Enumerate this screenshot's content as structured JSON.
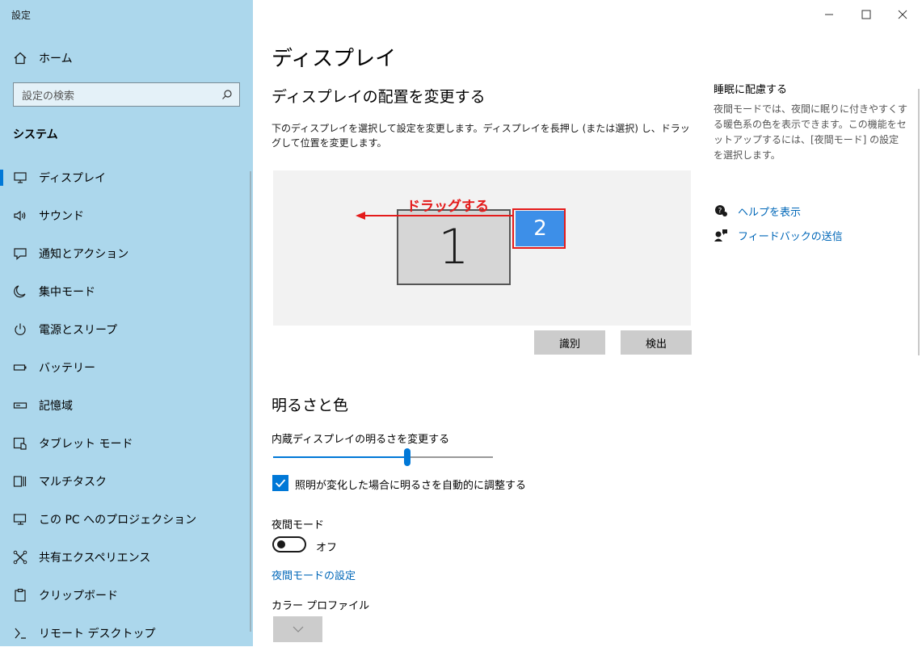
{
  "window": {
    "title": "設定"
  },
  "sidebar": {
    "home": "ホーム",
    "search_placeholder": "設定の検索",
    "section": "システム",
    "items": [
      {
        "label": "ディスプレイ",
        "icon": "monitor-icon",
        "selected": true
      },
      {
        "label": "サウンド",
        "icon": "speaker-icon"
      },
      {
        "label": "通知とアクション",
        "icon": "notification-icon"
      },
      {
        "label": "集中モード",
        "icon": "moon-icon"
      },
      {
        "label": "電源とスリープ",
        "icon": "power-icon"
      },
      {
        "label": "バッテリー",
        "icon": "battery-icon"
      },
      {
        "label": "記憶域",
        "icon": "storage-icon"
      },
      {
        "label": "タブレット モード",
        "icon": "tablet-icon"
      },
      {
        "label": "マルチタスク",
        "icon": "multitask-icon"
      },
      {
        "label": "この PC へのプロジェクション",
        "icon": "projection-icon"
      },
      {
        "label": "共有エクスペリエンス",
        "icon": "shared-icon"
      },
      {
        "label": "クリップボード",
        "icon": "clipboard-icon"
      },
      {
        "label": "リモート デスクトップ",
        "icon": "remote-desktop-icon"
      }
    ]
  },
  "main": {
    "title": "ディスプレイ",
    "arrange_title": "ディスプレイの配置を変更する",
    "arrange_desc": "下のディスプレイを選択して設定を変更します。ディスプレイを長押し (または選択) し、ドラッグして位置を変更します。",
    "monitors": [
      "1",
      "2"
    ],
    "annotation": "ドラッグする",
    "identify_button": "識別",
    "detect_button": "検出",
    "brightness_title": "明るさと色",
    "brightness_label": "内蔵ディスプレイの明るさを変更する",
    "brightness_value": 0.61,
    "auto_brightness_label": "照明が変化した場合に明るさを自動的に調整する",
    "auto_brightness_checked": true,
    "night_mode_label": "夜間モード",
    "night_mode_state": "オフ",
    "night_mode_settings_link": "夜間モードの設定",
    "color_profile_label": "カラー プロファイル"
  },
  "right": {
    "title": "睡眠に配慮する",
    "desc": "夜間モードでは、夜間に眠りに付きやすくする暖色系の色を表示できます。この機能をセットアップするには、[夜間モード] の設定を選択します。",
    "help_link": "ヘルプを表示",
    "feedback_link": "フィードバックの送信"
  },
  "colors": {
    "sidebar_bg": "#acd7ec",
    "accent": "#0078d7",
    "link": "#0067b8",
    "annotation": "#e41b1b"
  }
}
